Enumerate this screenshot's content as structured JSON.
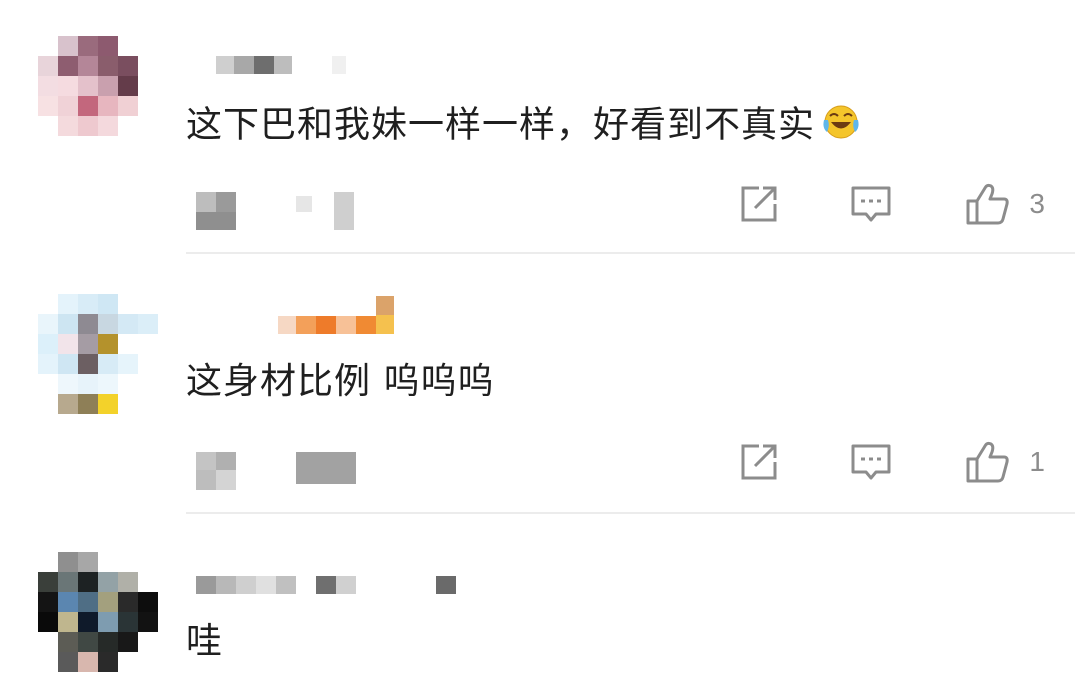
{
  "comments": [
    {
      "text": "这下巴和我妹一样一样，好看到不真实",
      "emoji": "laughing-crying-emoji",
      "likes": "3",
      "icons": {
        "share": "share-icon",
        "reply": "reply-icon",
        "like": "thumbs-up-icon"
      }
    },
    {
      "text": "这身材比例 呜呜呜",
      "likes": "1",
      "icons": {
        "share": "share-icon",
        "reply": "reply-icon",
        "like": "thumbs-up-icon"
      }
    },
    {
      "text": "哇"
    }
  ],
  "colors": {
    "text": "#1f1f1f",
    "icon": "#8c8c8c",
    "divider": "#ececec",
    "background": "#ffffff"
  }
}
